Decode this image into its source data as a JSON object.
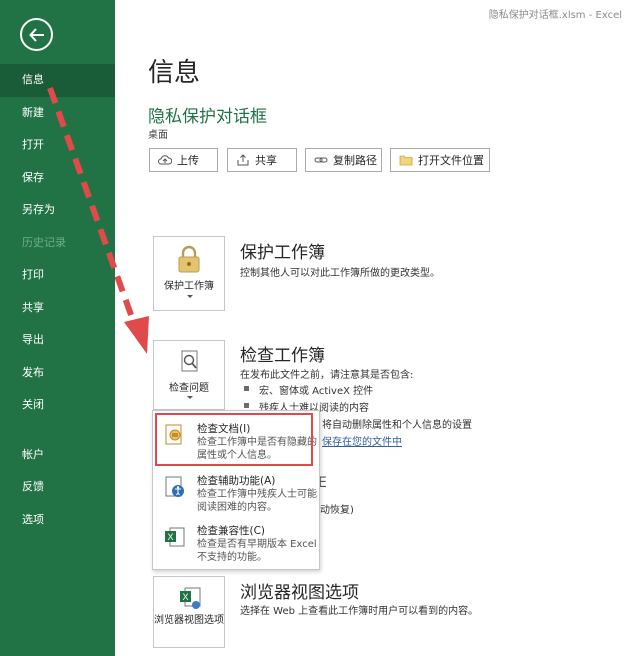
{
  "window": {
    "title": "隐私保护对话框.xlsm  -  Excel"
  },
  "sidebar": {
    "items": [
      {
        "label": "信息"
      },
      {
        "label": "新建"
      },
      {
        "label": "打开"
      },
      {
        "label": "保存"
      },
      {
        "label": "另存为"
      },
      {
        "label": "历史记录"
      },
      {
        "label": "打印"
      },
      {
        "label": "共享"
      },
      {
        "label": "导出"
      },
      {
        "label": "发布"
      },
      {
        "label": "关闭"
      },
      {
        "label": "帐户"
      },
      {
        "label": "反馈"
      },
      {
        "label": "选项"
      }
    ]
  },
  "page": {
    "title": "信息",
    "doc_title": "隐私保护对话框",
    "doc_location": "桌面"
  },
  "toolbar": {
    "upload": "上传",
    "share": "共享",
    "copy_path": "复制路径",
    "open_location": "打开文件位置"
  },
  "protect": {
    "button_label": "保护工作簿",
    "title": "保护工作簿",
    "desc": "控制其他人可以对此工作簿所做的更改类型。"
  },
  "inspect": {
    "button_label": "检查问题",
    "title": "检查工作簿",
    "desc": "在发布此文件之前，请注意其是否包含:",
    "bullet1": "宏、窗体或 ActiveX 控件",
    "bullet2": "残疾人士难以阅读的内容",
    "bullet3": "将自动删除属性和个人信息的设置",
    "link": "保存在您的文件中"
  },
  "menu": {
    "item1_title": "检查文档(I)",
    "item1_desc": "检查工作簿中是否有隐藏的属性或个人信息。",
    "item2_title": "检查辅助功能(A)",
    "item2_desc": "检查工作簿中残疾人士可能阅读困难的内容。",
    "item3_title": "检查兼容性(C)",
    "item3_desc": "检查是否有早期版本 Excel 不支持的功能。"
  },
  "manage_partial": {
    "frag1": "E",
    "frag2": "动恢复)"
  },
  "browser": {
    "button_label": "浏览器视图选项",
    "title": "浏览器视图选项",
    "desc": "选择在 Web 上查看此工作簿时用户可以看到的内容。"
  },
  "colors": {
    "sidebar": "#217346",
    "sidebar_active": "#1a5c38",
    "annotation": "#e04a4a"
  }
}
